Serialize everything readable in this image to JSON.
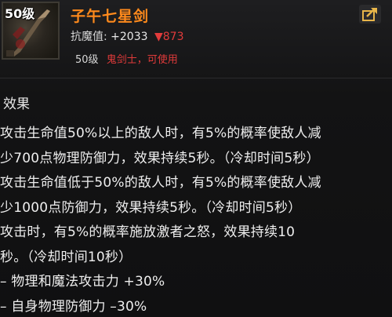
{
  "item": {
    "level_badge": "50级",
    "name": "子午七星剑",
    "stat_label": "抗魔值:",
    "stat_value": "+2033",
    "stat_diff": "▼873",
    "required_level": "50级",
    "required_class": "鬼剑士，可使用"
  },
  "section_title": "效果",
  "effect_lines": [
    "攻击生命值50%以上的敌人时，有5%的概率使敌人减",
    "少700点物理防御力，效果持续5秒。（冷却时间5秒）",
    "攻击生命值低于50%的敌人时，有5%的概率使敌人减",
    "少1000点防御力，效果持续5秒。（冷却时间5秒）",
    "攻击时，有5%的概率施放激者之怒，效果持续10",
    "秒。（冷却时间10秒）",
    " – 物理和魔法攻击力 +30%",
    " – 自身物理防御力 –30%"
  ],
  "colors": {
    "item_name": "#ff8a1c",
    "decrease": "#e23b3b",
    "class_requirement": "#e03a3a",
    "background": "#111112"
  },
  "icons": {
    "item": "sword-item-icon",
    "compare": "share-compare-icon"
  }
}
